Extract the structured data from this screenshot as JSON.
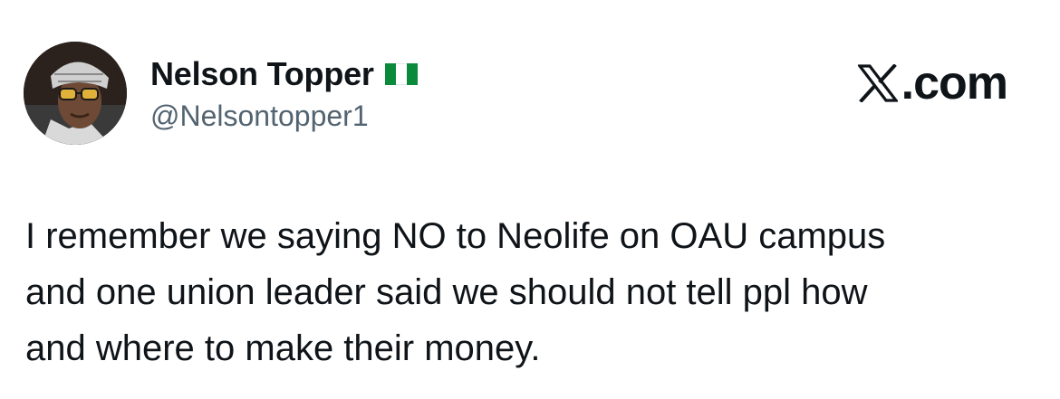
{
  "author": {
    "display_name": "Nelson Topper",
    "handle": "@Nelsontopper1",
    "flag_icon": "nigeria-flag-icon",
    "flag_colors": [
      "#0b8a3c",
      "#ffffff",
      "#0b8a3c"
    ]
  },
  "brand": {
    "icon": "x-logo-icon",
    "domain": ".com"
  },
  "tweet": {
    "lines": [
      "I remember we saying NO to Neolife on OAU campus",
      "and one union leader said we should not tell ppl how",
      "and where to make their money."
    ]
  },
  "colors": {
    "text_primary": "#0f1419",
    "text_secondary": "#536471",
    "background": "#ffffff"
  }
}
